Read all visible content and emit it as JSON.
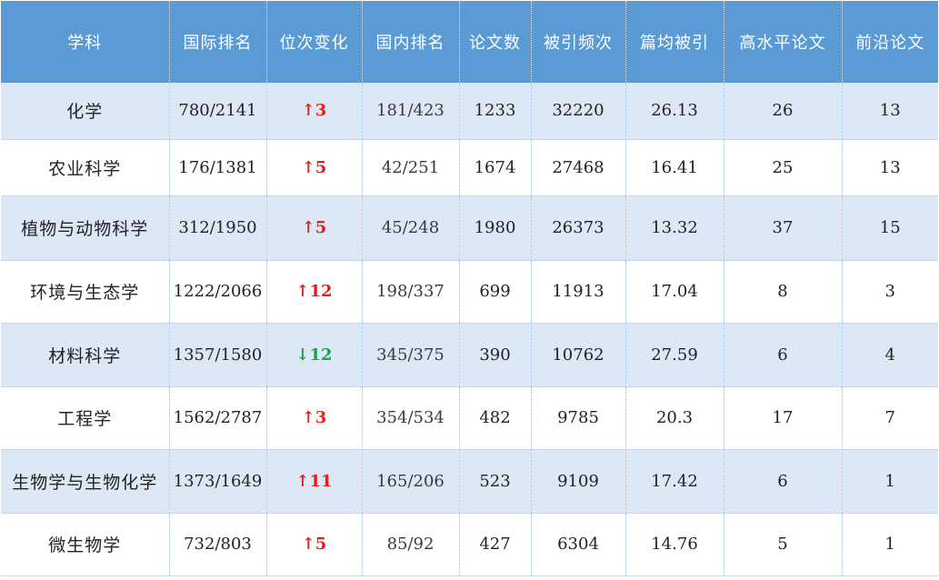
{
  "colors": {
    "header_bg": "#5b9bd5",
    "header_text": "#ffffff",
    "row_alt_bg": "#dce8f5",
    "up_color": "#e02020",
    "down_color": "#1aa34a"
  },
  "table": {
    "headers": [
      "学科",
      "国际排名",
      "位次变化",
      "国内排名",
      "论文数",
      "被引频次",
      "篇均被引",
      "高水平论文",
      "前沿论文"
    ],
    "rows": [
      {
        "subject": "化学",
        "intl_rank": "780/2141",
        "change_arrow": "↑",
        "change_value": "3",
        "change_dir": "up",
        "domestic_rank": "181/423",
        "papers": "1233",
        "citations": "32220",
        "avg_citations": "26.13",
        "high_level": "26",
        "frontier": "13"
      },
      {
        "subject": "农业科学",
        "intl_rank": "176/1381",
        "change_arrow": "↑",
        "change_value": "5",
        "change_dir": "up",
        "domestic_rank": "42/251",
        "papers": "1674",
        "citations": "27468",
        "avg_citations": "16.41",
        "high_level": "25",
        "frontier": "13"
      },
      {
        "subject": "植物与动物科学",
        "intl_rank": "312/1950",
        "change_arrow": "↑",
        "change_value": "5",
        "change_dir": "up",
        "domestic_rank": "45/248",
        "papers": "1980",
        "citations": "26373",
        "avg_citations": "13.32",
        "high_level": "37",
        "frontier": "15"
      },
      {
        "subject": "环境与生态学",
        "intl_rank": "1222/2066",
        "change_arrow": "↑",
        "change_value": "12",
        "change_dir": "up",
        "domestic_rank": "198/337",
        "papers": "699",
        "citations": "11913",
        "avg_citations": "17.04",
        "high_level": "8",
        "frontier": "3"
      },
      {
        "subject": "材料科学",
        "intl_rank": "1357/1580",
        "change_arrow": "↓",
        "change_value": "12",
        "change_dir": "down",
        "domestic_rank": "345/375",
        "papers": "390",
        "citations": "10762",
        "avg_citations": "27.59",
        "high_level": "6",
        "frontier": "4"
      },
      {
        "subject": "工程学",
        "intl_rank": "1562/2787",
        "change_arrow": "↑",
        "change_value": "3",
        "change_dir": "up",
        "domestic_rank": "354/534",
        "papers": "482",
        "citations": "9785",
        "avg_citations": "20.3",
        "high_level": "17",
        "frontier": "7"
      },
      {
        "subject": "生物学与生物化学",
        "intl_rank": "1373/1649",
        "change_arrow": "↑",
        "change_value": "11",
        "change_dir": "up",
        "domestic_rank": "165/206",
        "papers": "523",
        "citations": "9109",
        "avg_citations": "17.42",
        "high_level": "6",
        "frontier": "1"
      },
      {
        "subject": "微生物学",
        "intl_rank": "732/803",
        "change_arrow": "↑",
        "change_value": "5",
        "change_dir": "up",
        "domestic_rank": "85/92",
        "papers": "427",
        "citations": "6304",
        "avg_citations": "14.76",
        "high_level": "5",
        "frontier": "1"
      }
    ]
  }
}
